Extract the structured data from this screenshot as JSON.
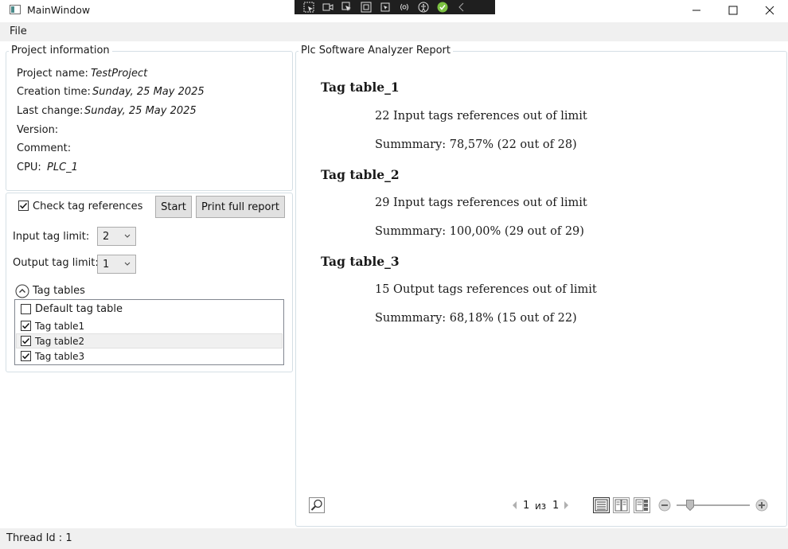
{
  "window": {
    "title": "MainWindow",
    "minimize_glyph": "—",
    "maximize_glyph": "☐",
    "close_glyph": "✕"
  },
  "menu": {
    "file": "File"
  },
  "project_info": {
    "header": "Project information",
    "rows": [
      {
        "label": "Project name:",
        "value": "TestProject"
      },
      {
        "label": "Creation time:",
        "value": "Sunday, 25 May 2025"
      },
      {
        "label": "Last change:",
        "value": "Sunday, 25 May 2025"
      },
      {
        "label": "Version:",
        "value": ""
      },
      {
        "label": "Comment:",
        "value": ""
      },
      {
        "label": "CPU:",
        "value": "PLC_1"
      }
    ]
  },
  "controls": {
    "check_tag_references": {
      "label": "Check tag references",
      "checked": true
    },
    "start_button": "Start",
    "print_button": "Print full report",
    "input_limit": {
      "label": "Input tag limit:",
      "value": "2"
    },
    "output_limit": {
      "label": "Output tag limit:",
      "value": "1"
    },
    "tag_tables_expander": "Tag tables",
    "tag_tables": [
      {
        "label": "Default tag table",
        "checked": false
      },
      {
        "label": "Tag table1",
        "checked": true
      },
      {
        "label": "Tag table2",
        "checked": true,
        "selected": true
      },
      {
        "label": "Tag table3",
        "checked": true
      }
    ]
  },
  "report": {
    "header": "Plc Software Analyzer Report",
    "sections": [
      {
        "title": "Tag table_1",
        "message": "22 Input tags references out of limit",
        "summary": "Summmary: 78,57% (22 out of 28)"
      },
      {
        "title": "Tag table_2",
        "message": "29 Input tags references out of limit",
        "summary": "Summmary: 100,00% (29 out of 29)"
      },
      {
        "title": "Tag table_3",
        "message": "15 Output tags references out of limit",
        "summary": "Summmary: 68,18% (15 out of 22)"
      }
    ],
    "pager": {
      "current": "1",
      "of_label": "из",
      "total": "1"
    },
    "zoom_level": 0.18
  },
  "status": {
    "text": "Thread Id : 1"
  },
  "colors": {
    "border": "#d5dfe5",
    "debug_toolbar": "#1f1f1f",
    "debug_check": "#7cc242",
    "menu_bg": "#f0f0f0"
  },
  "icons": {
    "debug": [
      "select-element-icon",
      "record-icon",
      "select-pointer-icon",
      "layout-adorner-icon",
      "track-focus-icon",
      "hot-reload-icon",
      "accessibility-icon",
      "check-icon",
      "collapse-icon"
    ],
    "viewer": [
      "find-icon",
      "prev-page-icon",
      "next-page-icon",
      "single-page-icon",
      "two-page-icon",
      "thumbnails-icon",
      "zoom-out-icon",
      "zoom-in-icon"
    ]
  }
}
